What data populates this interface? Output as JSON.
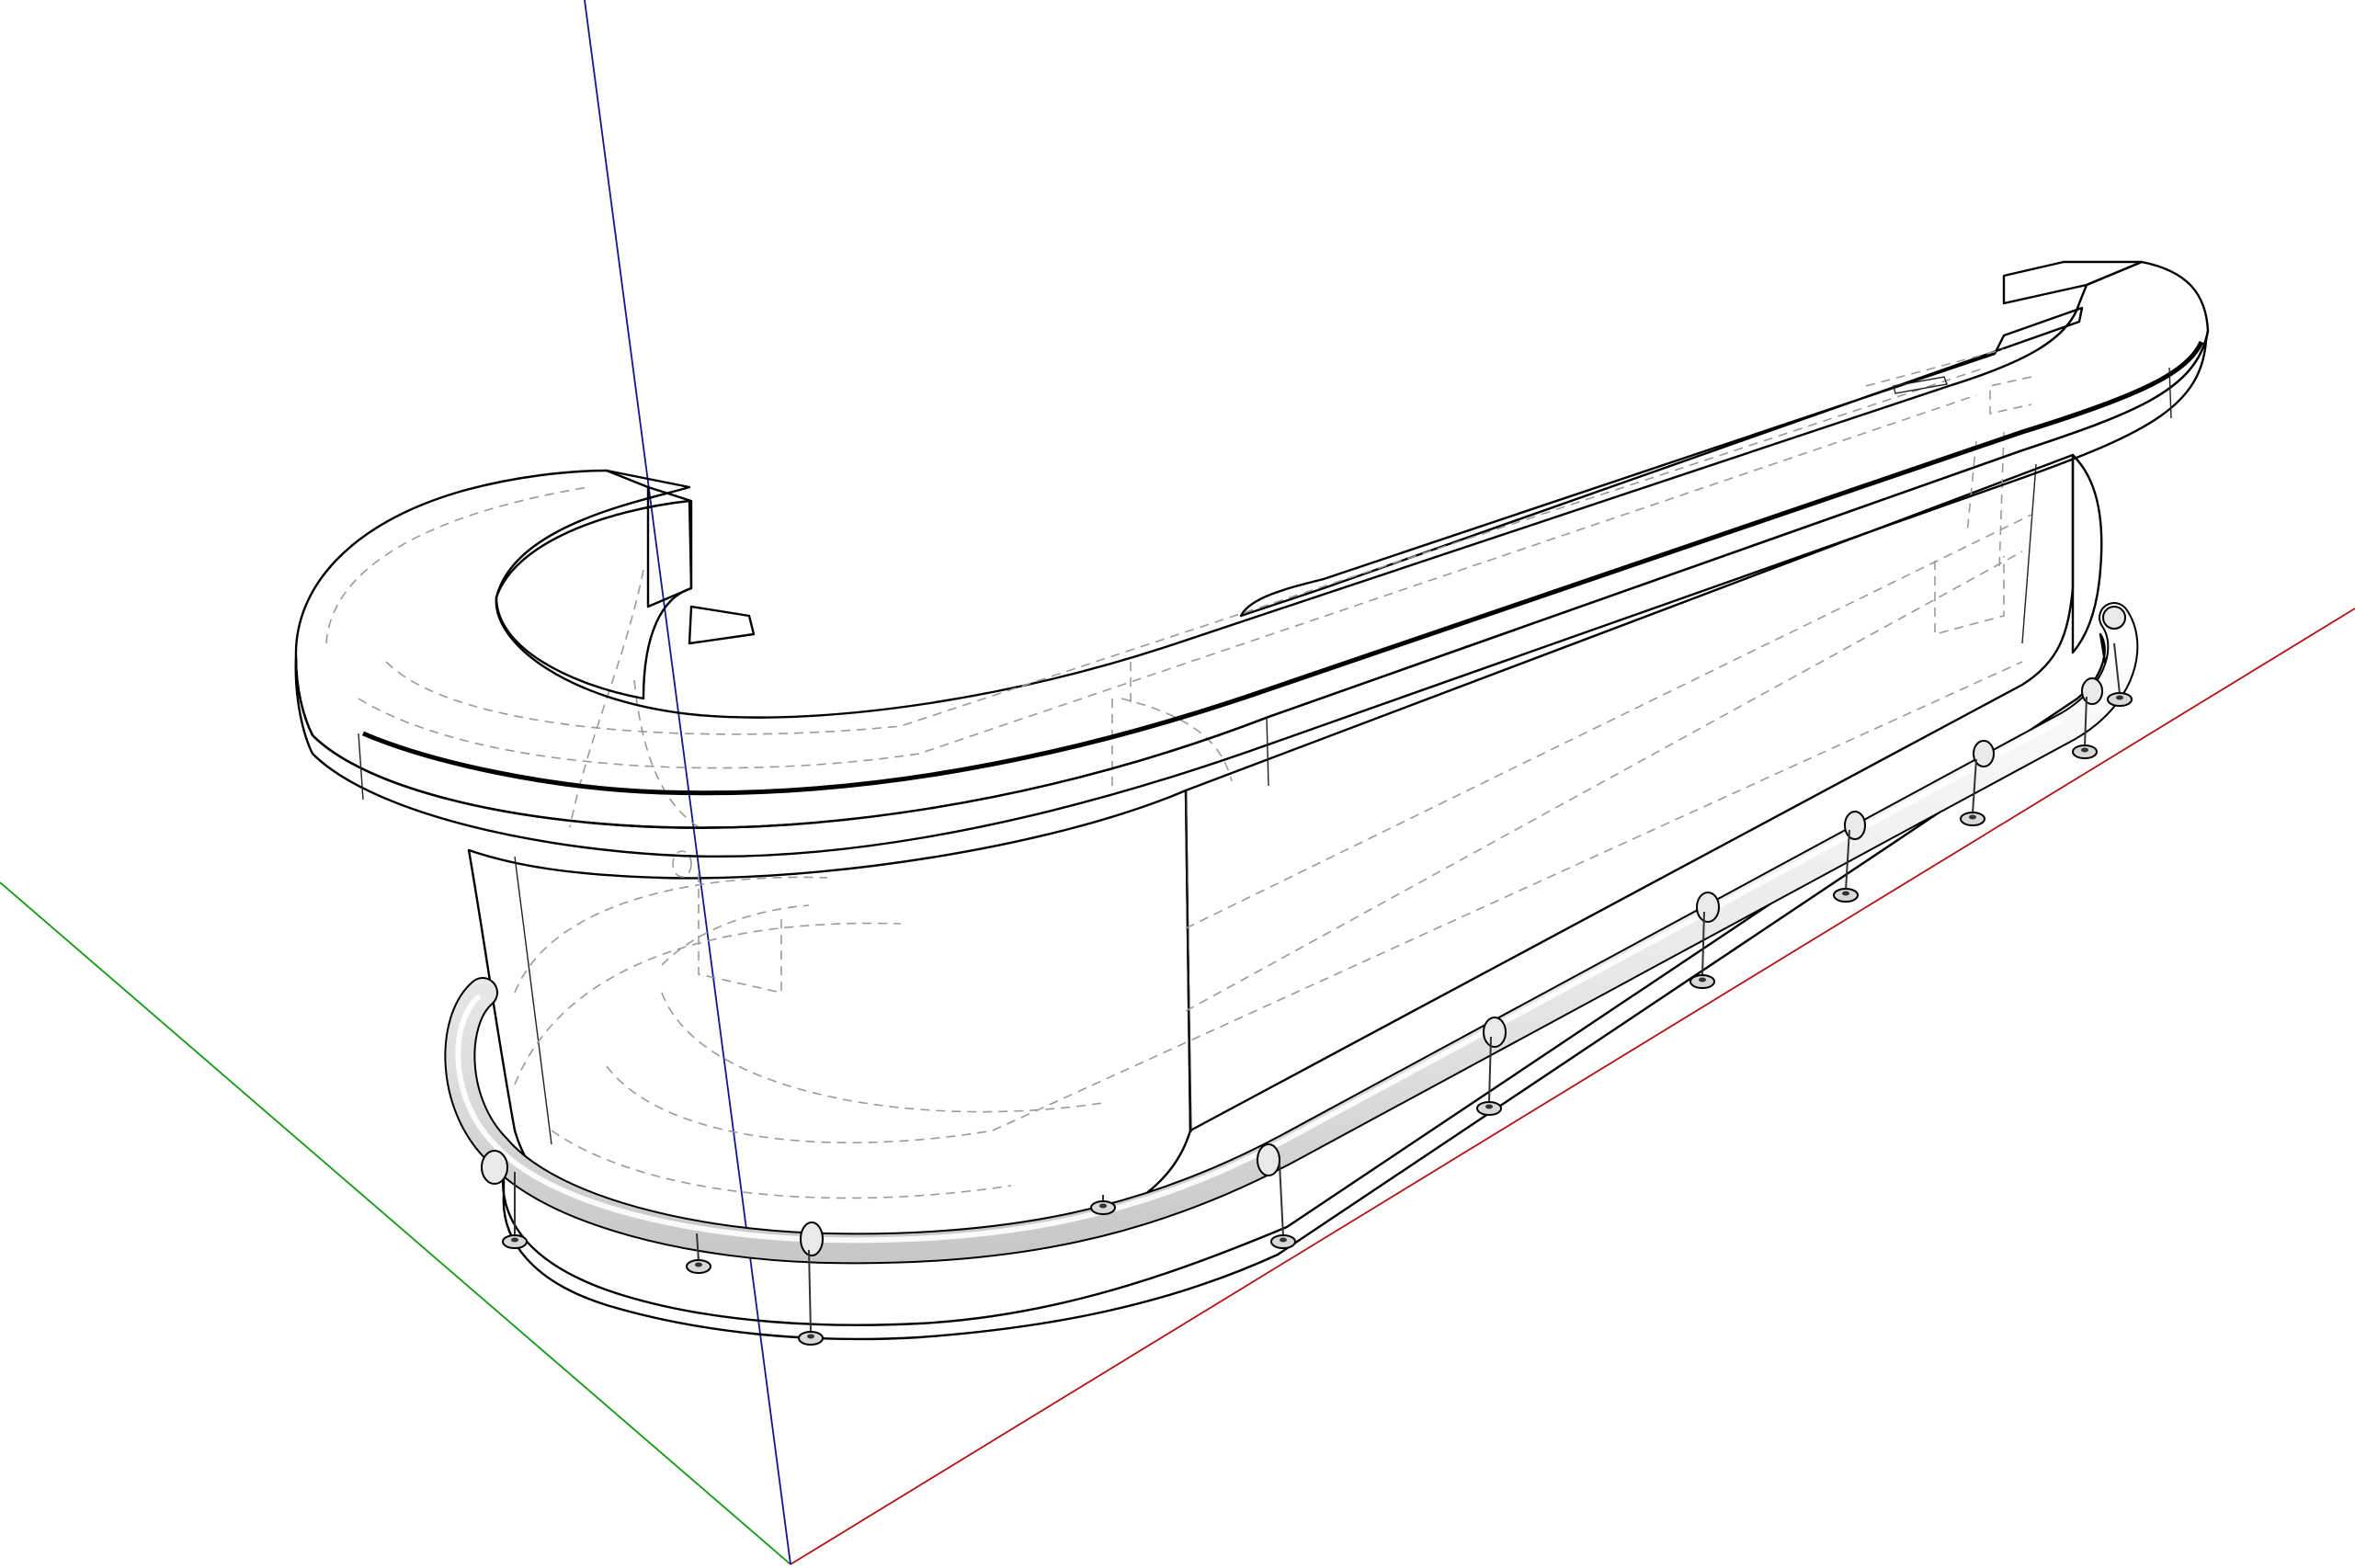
{
  "viewport": {
    "background": "#ffffff",
    "style": "hidden-line x-ray with dashed back edges"
  },
  "axes": {
    "red": "#b01010",
    "green": "#109010",
    "blue": "#101090"
  },
  "model": {
    "name": "",
    "counter_fill_top": "#d2d2d2",
    "counter_fill_face": "#ececec",
    "rail_color": "#e8e8e8",
    "support_count": 11
  }
}
